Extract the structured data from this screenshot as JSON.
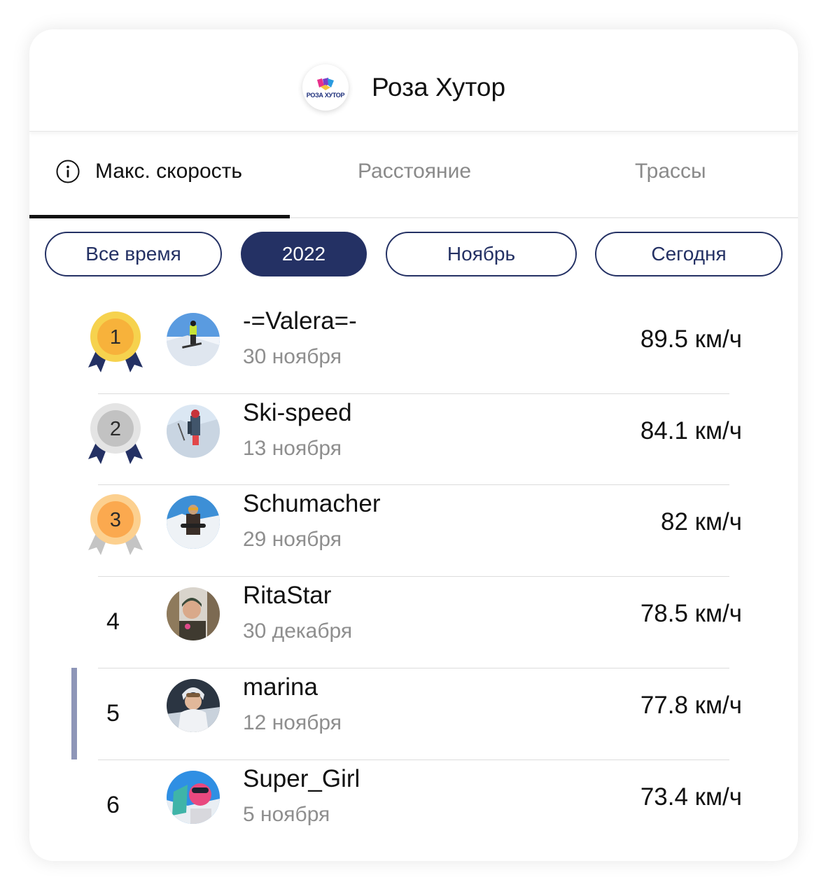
{
  "header": {
    "logo_text": "РОЗА ХУТОР",
    "resort_name": "Роза Хутор"
  },
  "tabs": [
    {
      "label": "Макс. скорость",
      "active": true,
      "icon": "info-icon"
    },
    {
      "label": "Расстояние",
      "active": false
    },
    {
      "label": "Трассы",
      "active": false
    }
  ],
  "filters": [
    {
      "label": "Все время",
      "active": false
    },
    {
      "label": "2022",
      "active": true
    },
    {
      "label": "Ноябрь",
      "active": false
    },
    {
      "label": "Сегодня",
      "active": false
    }
  ],
  "colors": {
    "accent": "#243164",
    "gold": "#f7b23b",
    "silver": "#c2c2c2",
    "bronze": "#fba94f",
    "current_user_bar": "#8e96b8"
  },
  "leaderboard": [
    {
      "rank": "1",
      "medal": "gold-medal-icon",
      "name": "-=Valera=-",
      "date": "30 ноября",
      "speed": "89.5 км/ч"
    },
    {
      "rank": "2",
      "medal": "silver-medal-icon",
      "name": "Ski-speed",
      "date": "13 ноября",
      "speed": "84.1 км/ч"
    },
    {
      "rank": "3",
      "medal": "bronze-medal-icon",
      "name": "Schumacher",
      "date": "29 ноября",
      "speed": "82 км/ч"
    },
    {
      "rank": "4",
      "name": "RitaStar",
      "date": "30 декабря",
      "speed": "78.5 км/ч"
    },
    {
      "rank": "5",
      "name": "marina",
      "date": "12 ноября",
      "speed": "77.8 км/ч",
      "current_user": true
    },
    {
      "rank": "6",
      "name": "Super_Girl",
      "date": "5 ноября",
      "speed": "73.4 км/ч"
    }
  ]
}
